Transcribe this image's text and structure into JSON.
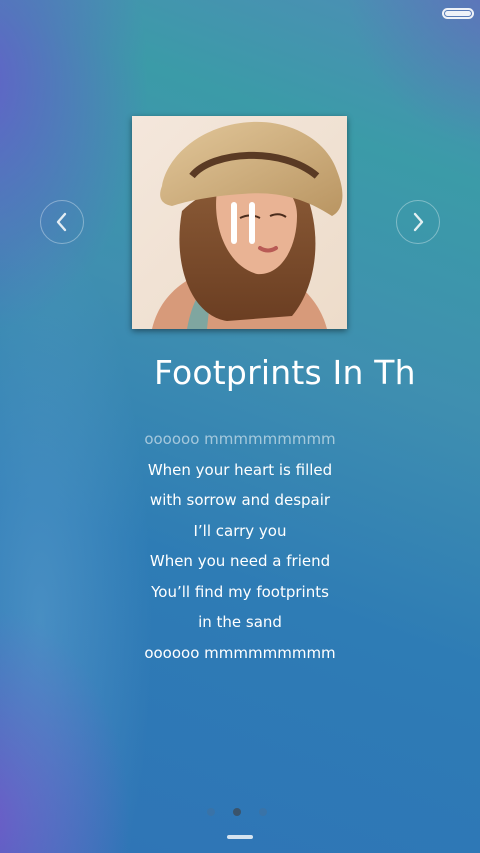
{
  "status_bar": {
    "battery_icon": "battery-full-icon",
    "battery_level": 1.0
  },
  "player": {
    "song_title": "Footprints In The",
    "album_art_icon": "album-art-woman-straw-hat",
    "prev_icon": "chevron-left-icon",
    "next_icon": "chevron-right-icon",
    "pause_icon": "pause-icon",
    "lyrics": [
      "oooooo mmmmmmmmm",
      "When your heart is filled",
      "with sorrow and despair",
      "I’ll carry you",
      "When you need a friend",
      "You’ll find my footprints",
      "in the sand",
      "oooooo mmmmmmmmm"
    ]
  },
  "pager": {
    "pages": 3,
    "active_index": 1
  },
  "colors": {
    "background_top": "#3b9ba8",
    "background_bottom": "#2f74b6",
    "accent_purple": "#6e4fd2",
    "text": "#ffffff"
  }
}
